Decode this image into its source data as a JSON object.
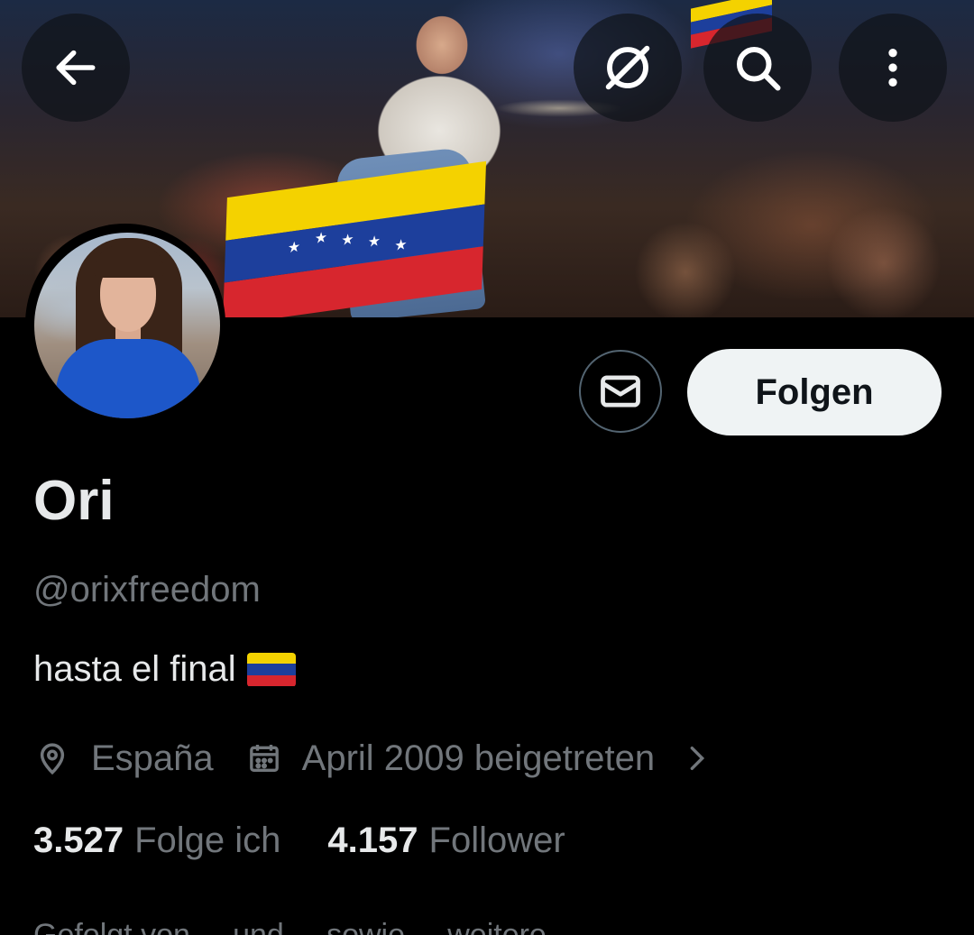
{
  "header": {
    "back_icon": "arrow-left-icon",
    "grok_icon": "grok-icon",
    "search_icon": "search-icon",
    "more_icon": "more-vertical-icon"
  },
  "banner": {
    "flag_colors": [
      "#f4d200",
      "#1d3f9c",
      "#d7262e"
    ]
  },
  "profile": {
    "name": "Ori",
    "handle": "@orixfreedom",
    "bio": "hasta el final",
    "bio_emoji": "venezuela-flag",
    "location": "España",
    "joined": "April 2009 beigetreten",
    "following_count": "3.527",
    "following_label": "Folge ich",
    "followers_count": "4.157",
    "followers_label": "Follower",
    "followed_by_text": "Gefolgt von ... und ... sowie ... weitere"
  },
  "actions": {
    "message_icon": "mail-icon",
    "follow_label": "Folgen"
  },
  "colors": {
    "background": "#000000",
    "primary_text": "#e7e9ea",
    "secondary_text": "#71767b",
    "follow_button_bg": "#eff3f4",
    "follow_button_text": "#0f1419",
    "border": "#536471"
  }
}
